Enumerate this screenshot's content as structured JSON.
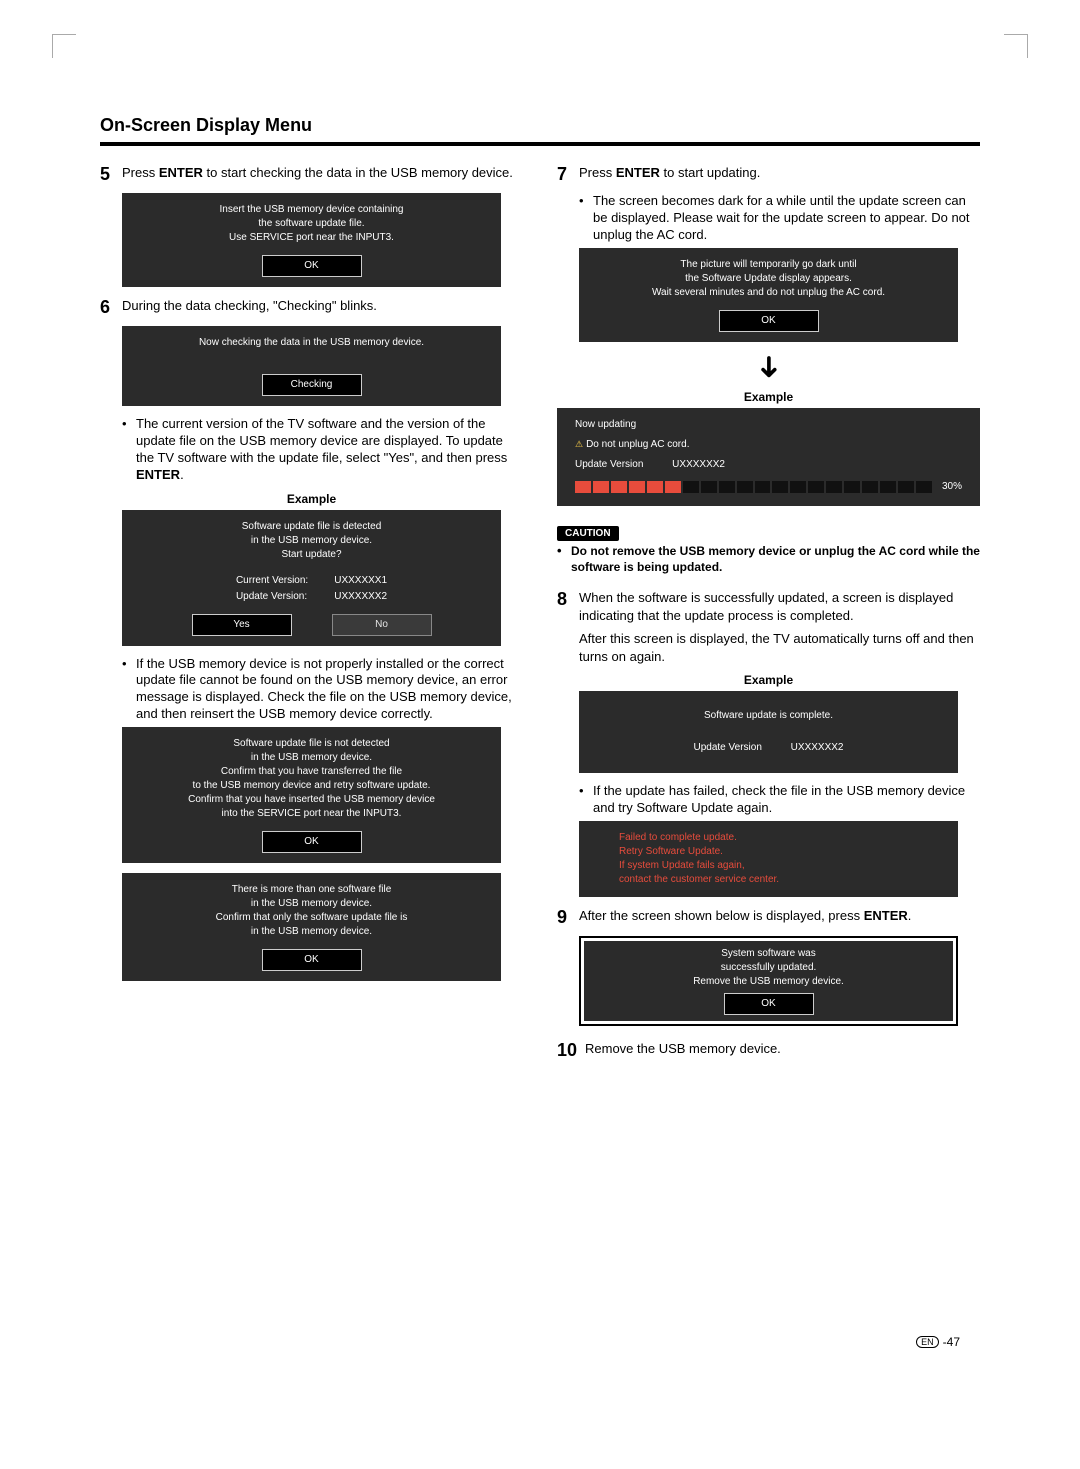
{
  "header": {
    "title": "On-Screen Display Menu"
  },
  "left": {
    "step5": {
      "num": "5",
      "textA": "Press ",
      "enter": "ENTER",
      "textB": " to start checking the data in the USB memory device.",
      "dialog": {
        "line1": "Insert the USB memory device containing",
        "line2": "the software update file.",
        "line3": "Use SERVICE port near the INPUT3.",
        "btn": "OK"
      }
    },
    "step6": {
      "num": "6",
      "text": "During the data checking, \"Checking\" blinks.",
      "dialog": {
        "msg": "Now checking the data in the USB memory device.",
        "btn": "Checking"
      },
      "bullet1": "The current version of the TV software and the version of the update file on the USB memory device are displayed. To update the TV software with the update file, select \"Yes\", and then press ",
      "bullet1b": ".",
      "example": "Example",
      "detected": {
        "line1": "Software update file is detected",
        "line2": "in the USB memory device.",
        "line3": "Start update?",
        "cvLabel": "Current Version:",
        "cvVal": "UXXXXXX1",
        "uvLabel": "Update Version:",
        "uvVal": "UXXXXXX2",
        "yes": "Yes",
        "no": "No"
      },
      "bullet2": "If the USB memory device is not properly installed or the correct update file cannot be found on the USB memory device, an error message is displayed. Check the file on the USB memory device, and then reinsert the USB memory device correctly.",
      "notdetected": {
        "line1": "Software update file is not detected",
        "line2": "in the USB memory device.",
        "line3": "Confirm that you have transferred the file",
        "line4": "to the USB memory device and retry software update.",
        "line5": "Confirm that you have inserted the USB memory device",
        "line6": "into the SERVICE port near the INPUT3.",
        "btn": "OK"
      },
      "multiple": {
        "line1": "There is more than one software file",
        "line2": "in the USB memory device.",
        "line3": "Confirm that only the software update file is",
        "line4": "in the USB memory device.",
        "btn": "OK"
      }
    }
  },
  "right": {
    "step7": {
      "num": "7",
      "textA": "Press ",
      "enter": "ENTER",
      "textB": " to start updating.",
      "bullet": "The screen becomes dark for a while until the update screen can be displayed. Please wait for the update screen to appear. Do not unplug the AC cord.",
      "dialog": {
        "line1": "The picture will temporarily go dark until",
        "line2": "the Software Update display appears.",
        "line3": "Wait several minutes and do not unplug the AC cord.",
        "btn": "OK"
      },
      "example": "Example",
      "updating": {
        "title": "Now updating",
        "warn": "Do not unplug AC cord.",
        "uvLabel": "Update Version",
        "uvVal": "UXXXXXX2",
        "pct": "30%"
      }
    },
    "caution": {
      "badge": "CAUTION",
      "text": "Do not remove the USB memory device or unplug the AC cord while the software is being updated."
    },
    "step8": {
      "num": "8",
      "para1": "When the software is successfully updated, a screen is displayed indicating that the update process is completed.",
      "para2": "After this screen is displayed, the TV automatically turns off and then turns on again.",
      "example": "Example",
      "complete": {
        "msg": "Software update is complete.",
        "uvLabel": "Update Version",
        "uvVal": "UXXXXXX2"
      },
      "bullet": "If the update has failed, check the file in the USB memory device and try Software Update again.",
      "failed": {
        "line1": "Failed to complete update.",
        "line2": "Retry Software Update.",
        "line3": "If system Update fails again,",
        "line4": "contact the customer service center."
      }
    },
    "step9": {
      "num": "9",
      "textA": "After the screen shown below is displayed, press ",
      "enter": "ENTER",
      "textB": ".",
      "success": {
        "line1": "System software was",
        "line2": "successfully updated.",
        "line3": "Remove the USB memory device.",
        "btn": "OK"
      }
    },
    "step10": {
      "num": "10",
      "text": "Remove the USB memory device."
    }
  },
  "footer": {
    "en": "EN",
    "sep": " - ",
    "page": "47"
  }
}
